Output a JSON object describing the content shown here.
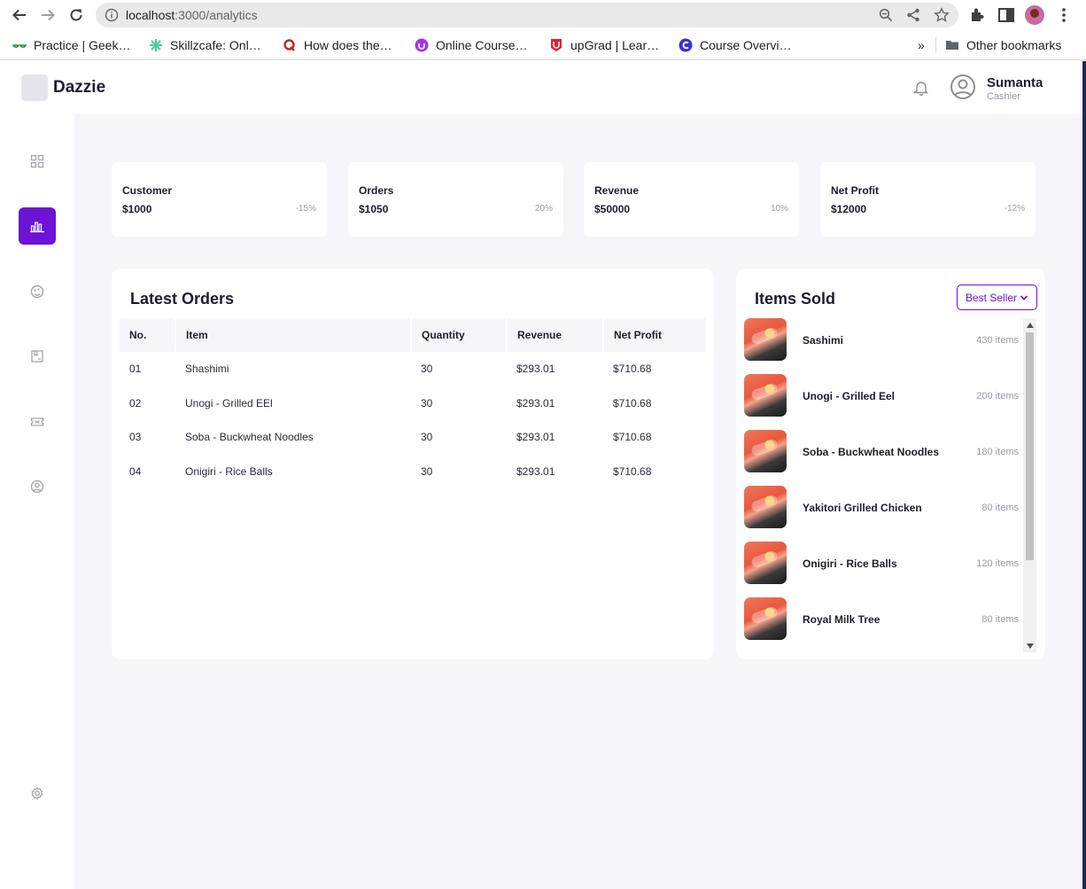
{
  "browser": {
    "url_host": "localhost",
    "url_path": ":3000/analytics",
    "bookmarks": [
      {
        "label": "Practice | Geek…",
        "icon": "geeksforgeeks-icon",
        "color": "#2f8d46"
      },
      {
        "label": "Skillzcafe: Onl…",
        "icon": "skillzcafe-icon",
        "color": "#3ecfa0"
      },
      {
        "label": "How does the…",
        "icon": "quora-icon",
        "color": "#b92b27"
      },
      {
        "label": "Online Course…",
        "icon": "udemy-icon",
        "color": "#a435f0"
      },
      {
        "label": "upGrad | Lear…",
        "icon": "upgrad-icon",
        "color": "#e5202e"
      },
      {
        "label": "Course Overvi…",
        "icon": "coursera-icon",
        "color": "#3b2fd6"
      }
    ],
    "bookmarks_more": "»",
    "other_bookmarks": "Other bookmarks"
  },
  "app": {
    "brand": "Dazzie",
    "accent_color": "#6c13d6",
    "user": {
      "name": "Sumanta",
      "role": "Cashier"
    }
  },
  "sidebar": {
    "items": [
      {
        "icon": "grid-icon",
        "active": false
      },
      {
        "icon": "bar-chart-icon",
        "active": true
      },
      {
        "icon": "palette-icon",
        "active": false
      },
      {
        "icon": "box-icon",
        "active": false
      },
      {
        "icon": "ticket-icon",
        "active": false
      },
      {
        "icon": "user-circle-icon",
        "active": false
      }
    ],
    "bottom_icon": "gear-icon"
  },
  "stats": [
    {
      "label": "Customer",
      "value": "$1000",
      "change": "-15%"
    },
    {
      "label": "Orders",
      "value": "$1050",
      "change": "20%"
    },
    {
      "label": "Revenue",
      "value": "$50000",
      "change": "10%"
    },
    {
      "label": "Net Profit",
      "value": "$12000",
      "change": "-12%"
    }
  ],
  "latest_orders": {
    "title": "Latest Orders",
    "columns": [
      "No.",
      "Item",
      "Quantity",
      "Revenue",
      "Net Profit"
    ],
    "rows": [
      {
        "no": "01",
        "item": "Shashimi",
        "quantity": "30",
        "revenue": "$293.01",
        "net_profit": "$710.68"
      },
      {
        "no": "02",
        "item": "Unogi - Grilled EEl",
        "quantity": "30",
        "revenue": "$293.01",
        "net_profit": "$710.68"
      },
      {
        "no": "03",
        "item": "Soba - Buckwheat Noodles",
        "quantity": "30",
        "revenue": "$293.01",
        "net_profit": "$710.68"
      },
      {
        "no": "04",
        "item": "Onigiri - Rice Balls",
        "quantity": "30",
        "revenue": "$293.01",
        "net_profit": "$710.68"
      }
    ]
  },
  "items_sold": {
    "title": "Items Sold",
    "filter": "Best Seller",
    "items": [
      {
        "name": "Sashimi",
        "count": "430 items"
      },
      {
        "name": "Unogi - Grilled Eel",
        "count": "200 items"
      },
      {
        "name": "Soba - Buckwheat Noodles",
        "count": "180 items"
      },
      {
        "name": "Yakitori Grilled Chicken",
        "count": "80 items"
      },
      {
        "name": "Onigiri - Rice Balls",
        "count": "120 items"
      },
      {
        "name": "Royal Milk Tree",
        "count": "80 items"
      }
    ]
  }
}
